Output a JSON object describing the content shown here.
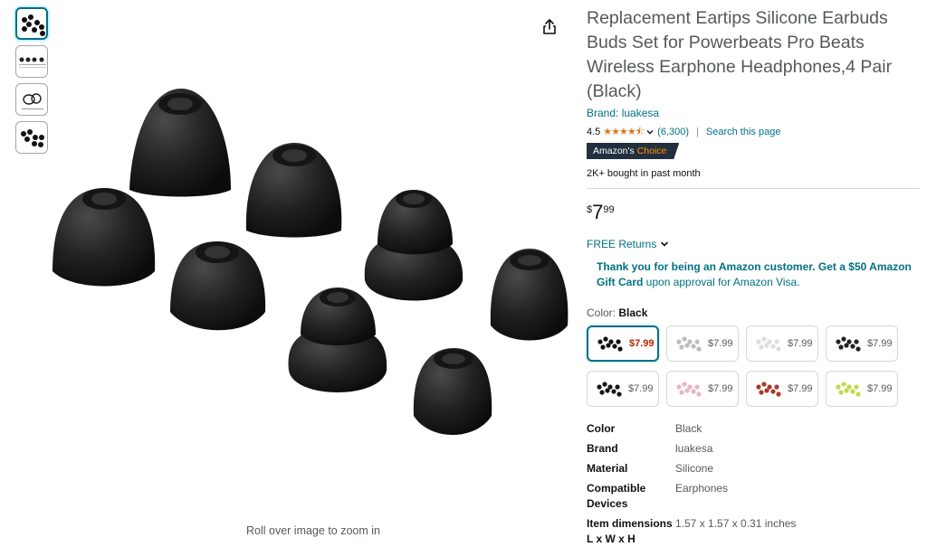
{
  "product": {
    "title": "Replacement Eartips Silicone Earbuds Buds Set for Powerbeats Pro Beats Wireless Earphone Headphones,4 Pair (Black)",
    "brand_link": "Brand: luakesa",
    "rating": "4.5",
    "stars": "★★★★⯪",
    "rating_count": "(6,300)",
    "search_page": "Search this page",
    "badge_prefix": "Amazon's",
    "badge_choice": "Choice",
    "bought": "2K+ bought in past month",
    "price_symbol": "$",
    "price_whole": "7",
    "price_fraction": "99",
    "returns": "FREE Returns",
    "offer_bold": "Thank you for being an Amazon customer. Get a $50 Amazon Gift Card",
    "offer_rest": " upon approval for Amazon Visa.",
    "color_label": "Color: ",
    "color_value": "Black"
  },
  "gallery": {
    "zoom_hint": "Roll over image to zoom in"
  },
  "swatches": [
    {
      "price": "$7.99",
      "color": "#111111"
    },
    {
      "price": "$7.99",
      "color": "#bdbdbd"
    },
    {
      "price": "$7.99",
      "color": "#dcdcdc"
    },
    {
      "price": "$7.99",
      "color": "#222222"
    },
    {
      "price": "$7.99",
      "color": "#161616"
    },
    {
      "price": "$7.99",
      "color": "#e7b6c1"
    },
    {
      "price": "$7.99",
      "color": "#a83a2a"
    },
    {
      "price": "$7.99",
      "color": "#c4d94a"
    }
  ],
  "specs": [
    {
      "key": "Color",
      "value": "Black"
    },
    {
      "key": "Brand",
      "value": "luakesa"
    },
    {
      "key": "Material",
      "value": "Silicone"
    },
    {
      "key": "Compatible Devices",
      "value": "Earphones"
    },
    {
      "key": "Item dimensions L x W x H",
      "value": "1.57 x 1.57 x 0.31 inches"
    }
  ],
  "colors": {
    "link": "#007185",
    "star": "#de7921",
    "badge_bg": "#232f3e",
    "choice": "#ff9900",
    "price_red": "#b12704"
  },
  "icons": [
    "share-icon",
    "chevron-down-icon"
  ]
}
